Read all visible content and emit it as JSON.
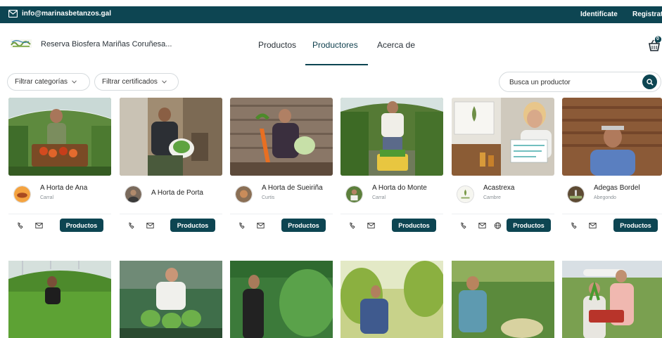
{
  "topbar": {
    "email": "info@marinasbetanzos.gal",
    "login_label": "Identifícate",
    "register_label": "Registrate"
  },
  "header": {
    "brand": "Reserva Biosfera Mariñas Coruñesa...",
    "nav": [
      "Productos",
      "Productores",
      "Acerca de"
    ],
    "active_nav": "Productores",
    "cart_count": "0"
  },
  "filters": {
    "categories_label": "Filtrar categorías",
    "certificates_label": "Filtrar certificados",
    "search_placeholder": "Busca un productor"
  },
  "producers": [
    {
      "name": "A Horta de Ana",
      "location": "Carral",
      "contacts": [
        "phone-icon",
        "mail-icon"
      ],
      "button": "Productos"
    },
    {
      "name": "A Horta de Porta",
      "location": "",
      "contacts": [
        "phone-icon",
        "mail-icon"
      ],
      "button": "Productos"
    },
    {
      "name": "A Horta de Sueiriña",
      "location": "Curtis",
      "contacts": [
        "phone-icon",
        "mail-icon"
      ],
      "button": "Productos"
    },
    {
      "name": "A Horta do Monte",
      "location": "Carral",
      "contacts": [
        "phone-icon",
        "mail-icon"
      ],
      "button": "Productos"
    },
    {
      "name": "Acastrexa",
      "location": "Cambre",
      "contacts": [
        "phone-icon",
        "mail-icon",
        "globe-icon"
      ],
      "button": "Productos"
    },
    {
      "name": "Adegas Bordel",
      "location": "Abegondo",
      "contacts": [
        "phone-icon",
        "mail-icon"
      ],
      "button": "Productos"
    }
  ],
  "colors": {
    "brand": "#0d4552",
    "divider": "#eceff1",
    "chip_border": "#d6dbde"
  }
}
